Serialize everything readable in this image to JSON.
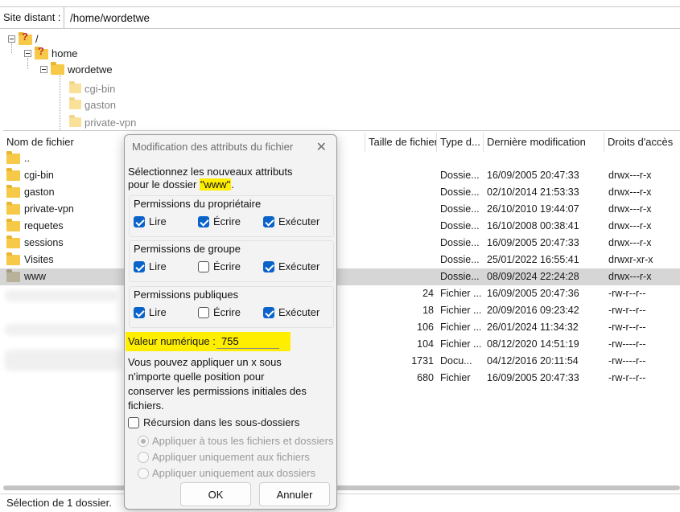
{
  "site": {
    "label": "Site distant :",
    "path": "/home/wordetwe"
  },
  "tree": {
    "root": "/",
    "home": "home",
    "user": "wordetwe",
    "children": [
      "cgi-bin",
      "gaston",
      "private-vpn"
    ]
  },
  "columns": [
    "Nom de fichier",
    "Taille de fichier",
    "Type d...",
    "Dernière modification",
    "Droits d'accès"
  ],
  "rows": [
    {
      "name": "..",
      "size": "",
      "type": "",
      "date": "",
      "rights": ""
    },
    {
      "name": "cgi-bin",
      "size": "",
      "type": "Dossie...",
      "date": "16/09/2005 20:47:33",
      "rights": "drwx---r-x"
    },
    {
      "name": "gaston",
      "size": "",
      "type": "Dossie...",
      "date": "02/10/2014 21:53:33",
      "rights": "drwx---r-x"
    },
    {
      "name": "private-vpn",
      "size": "",
      "type": "Dossie...",
      "date": "26/10/2010 19:44:07",
      "rights": "drwx---r-x"
    },
    {
      "name": "requetes",
      "size": "",
      "type": "Dossie...",
      "date": "16/10/2008 00:38:41",
      "rights": "drwx---r-x"
    },
    {
      "name": "sessions",
      "size": "",
      "type": "Dossie...",
      "date": "16/09/2005 20:47:33",
      "rights": "drwx---r-x"
    },
    {
      "name": "Visites",
      "size": "",
      "type": "Dossie...",
      "date": "25/01/2022 16:55:41",
      "rights": "drwxr-xr-x"
    },
    {
      "name": "www",
      "size": "",
      "type": "Dossie...",
      "date": "08/09/2024 22:24:28",
      "rights": "drwx---r-x"
    },
    {
      "name": "",
      "size": "24",
      "type": "Fichier ...",
      "date": "16/09/2005 20:47:36",
      "rights": "-rw-r--r--"
    },
    {
      "name": "",
      "size": "18",
      "type": "Fichier ...",
      "date": "20/09/2016 09:23:42",
      "rights": "-rw-r--r--"
    },
    {
      "name": "",
      "size": "106",
      "type": "Fichier ...",
      "date": "26/01/2024 11:34:32",
      "rights": "-rw-r--r--"
    },
    {
      "name": "",
      "size": "104",
      "type": "Fichier ...",
      "date": "08/12/2020 14:51:19",
      "rights": "-rw----r--"
    },
    {
      "name": "",
      "size": "1731",
      "type": "Docu...",
      "date": "04/12/2016 20:11:54",
      "rights": "-rw----r--"
    },
    {
      "name": "",
      "size": "680",
      "type": "Fichier",
      "date": "16/09/2005 20:47:33",
      "rights": "-rw-r--r--"
    }
  ],
  "status": "Sélection de 1 dossier.",
  "dialog": {
    "title": "Modification des attributs du fichier",
    "intro_line1": "Sélectionnez les nouveaux attributs",
    "intro_line2_prefix": "pour le dossier ",
    "folder_quoted": "\"www\"",
    "intro_line2_suffix": ".",
    "owner": {
      "title": "Permissions du propriétaire",
      "read": "Lire",
      "write": "Écrire",
      "exec": "Exécuter"
    },
    "group": {
      "title": "Permissions de groupe",
      "read": "Lire",
      "write": "Écrire",
      "exec": "Exécuter"
    },
    "public": {
      "title": "Permissions publiques",
      "read": "Lire",
      "write": "Écrire",
      "exec": "Exécuter"
    },
    "numeric_label": "Valeur numérique :",
    "numeric_value": "755",
    "help_lines": [
      "Vous pouvez appliquer un x sous",
      "n'importe quelle position pour",
      "conserver les permissions initiales des",
      "fichiers."
    ],
    "recursion_label": "Récursion dans les sous-dossiers",
    "radio_all": "Appliquer à tous les fichiers et dossiers",
    "radio_files": "Appliquer uniquement aux fichiers",
    "radio_dirs": "Appliquer uniquement aux dossiers",
    "ok": "OK",
    "cancel": "Annuler",
    "close_glyph": "✕"
  },
  "colors": {
    "highlight": "#ffee00",
    "checkbox": "#0a63c9",
    "folder": "#f7c948",
    "selected_row": "#d6d6d6"
  }
}
